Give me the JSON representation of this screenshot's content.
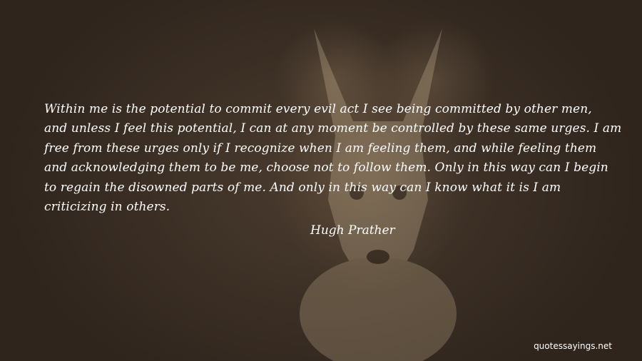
{
  "quote": {
    "lines": [
      "Within me is the potential to commit every evil act I see being committed by other men,",
      "and unless I feel this potential, I can at any moment be controlled by these same urges. I am",
      "free from these urges only if I recognize when I am feeling them, and while feeling them",
      "and acknowledging them to be me, choose not to follow them. Only in this way can I begin",
      "to regain the disowned parts of me. And only in this way can I know what it is I am",
      "criticizing in others."
    ],
    "author": "Hugh Prather"
  },
  "watermark": "quotessayings.net",
  "background": {
    "subject": "fox-photo",
    "tint": "#3b2f25"
  },
  "text_color": "#ffffff"
}
